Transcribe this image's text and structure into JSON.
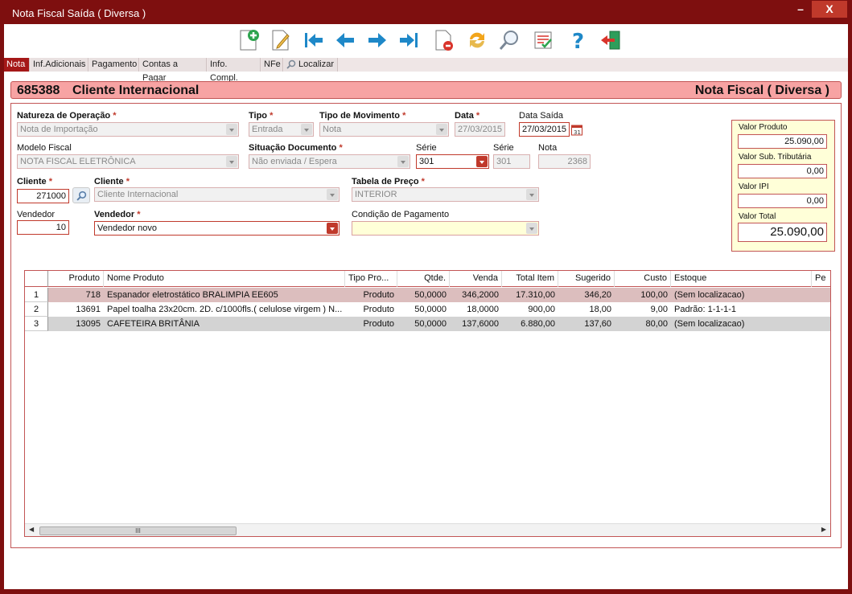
{
  "window": {
    "title": "Nota Fiscal Saída ( Diversa )",
    "minimize": "–",
    "close": "X"
  },
  "toolbar": [
    {
      "name": "new-icon"
    },
    {
      "name": "edit-icon"
    },
    {
      "name": "first-record-icon"
    },
    {
      "name": "previous-record-icon"
    },
    {
      "name": "next-record-icon"
    },
    {
      "name": "last-record-icon"
    },
    {
      "name": "delete-document-icon"
    },
    {
      "name": "refresh-icon"
    },
    {
      "name": "search-icon"
    },
    {
      "name": "checklist-icon"
    },
    {
      "name": "help-icon"
    },
    {
      "name": "exit-icon"
    }
  ],
  "tabs": [
    "Nota",
    "Inf.Adicionais",
    "Pagamento",
    "Contas a Pagar",
    "Info. Compl.",
    "NFe",
    "Localizar"
  ],
  "header": {
    "code": "685388",
    "client_name": "Cliente Internacional",
    "kind": "Nota Fiscal ( Diversa )"
  },
  "form": {
    "natureza_label": "Natureza de Operação",
    "natureza_value": "Nota de Importação",
    "tipo_label": "Tipo",
    "tipo_value": "Entrada",
    "tipo_mov_label": "Tipo de Movimento",
    "tipo_mov_value": "Nota",
    "data_label": "Data",
    "data_value": "27/03/2015",
    "data_saida_label": "Data Saída",
    "data_saida_value": "27/03/2015",
    "modelo_label": "Modelo Fiscal",
    "modelo_value": "NOTA FISCAL ELETRÔNICA",
    "situacao_label": "Situação Documento",
    "situacao_value": "Não enviada / Espera",
    "serie_label": "Série",
    "serie_value": "301",
    "serie2_label": "Série",
    "serie2_value": "301",
    "nota_label": "Nota",
    "nota_value": "2368",
    "cliente_label": "Cliente",
    "cliente_code": "271000",
    "cliente_name_label": "Cliente",
    "cliente_name_value": "Cliente Internacional",
    "tabela_label": "Tabela de Preço",
    "tabela_value": "INTERIOR",
    "vendedor_label": "Vendedor",
    "vendedor_code": "10",
    "vendedor_name_label": "Vendedor",
    "vendedor_name_value": "Vendedor novo",
    "condicao_label": "Condição de Pagamento",
    "condicao_value": "",
    "required_mark": "*"
  },
  "totals": {
    "valor_produto_label": "Valor Produto",
    "valor_produto": "25.090,00",
    "valor_sub_label": "Valor Sub. Tributária",
    "valor_sub": "0,00",
    "valor_ipi_label": "Valor IPI",
    "valor_ipi": "0,00",
    "valor_total_label": "Valor Total",
    "valor_total": "25.090,00"
  },
  "grid": {
    "columns": [
      "Produto",
      "Nome Produto",
      "Tipo Pro...",
      "Qtde.",
      "Venda",
      "Total Item",
      "Sugerido",
      "Custo",
      "Estoque",
      "Pe"
    ],
    "rows": [
      {
        "idx": "1",
        "produto": "718",
        "nome": "Espanador eletrostático BRALIMPIA EE605",
        "tipo": "Produto",
        "qtde": "50,0000",
        "venda": "346,2000",
        "total": "17.310,00",
        "sugerido": "346,20",
        "custo": "100,00",
        "estoque": "(Sem localizacao)"
      },
      {
        "idx": "2",
        "produto": "13691",
        "nome": "Papel toalha 23x20cm. 2D. c/1000fls.( celulose virgem ) N...",
        "tipo": "Produto",
        "qtde": "50,0000",
        "venda": "18,0000",
        "total": "900,00",
        "sugerido": "18,00",
        "custo": "9,00",
        "estoque": "Padrão: 1-1-1-1"
      },
      {
        "idx": "3",
        "produto": "13095",
        "nome": "CAFETEIRA BRITÂNIA",
        "tipo": "Produto",
        "qtde": "50,0000",
        "venda": "137,6000",
        "total": "6.880,00",
        "sugerido": "137,60",
        "custo": "80,00",
        "estoque": "(Sem localizacao)"
      }
    ],
    "scroll_thumb": "III"
  },
  "colors": {
    "frame": "#7e0f0f",
    "accent": "#c0392b",
    "header_band": "#f7a3a3",
    "totals_bg": "#ffffd8"
  }
}
